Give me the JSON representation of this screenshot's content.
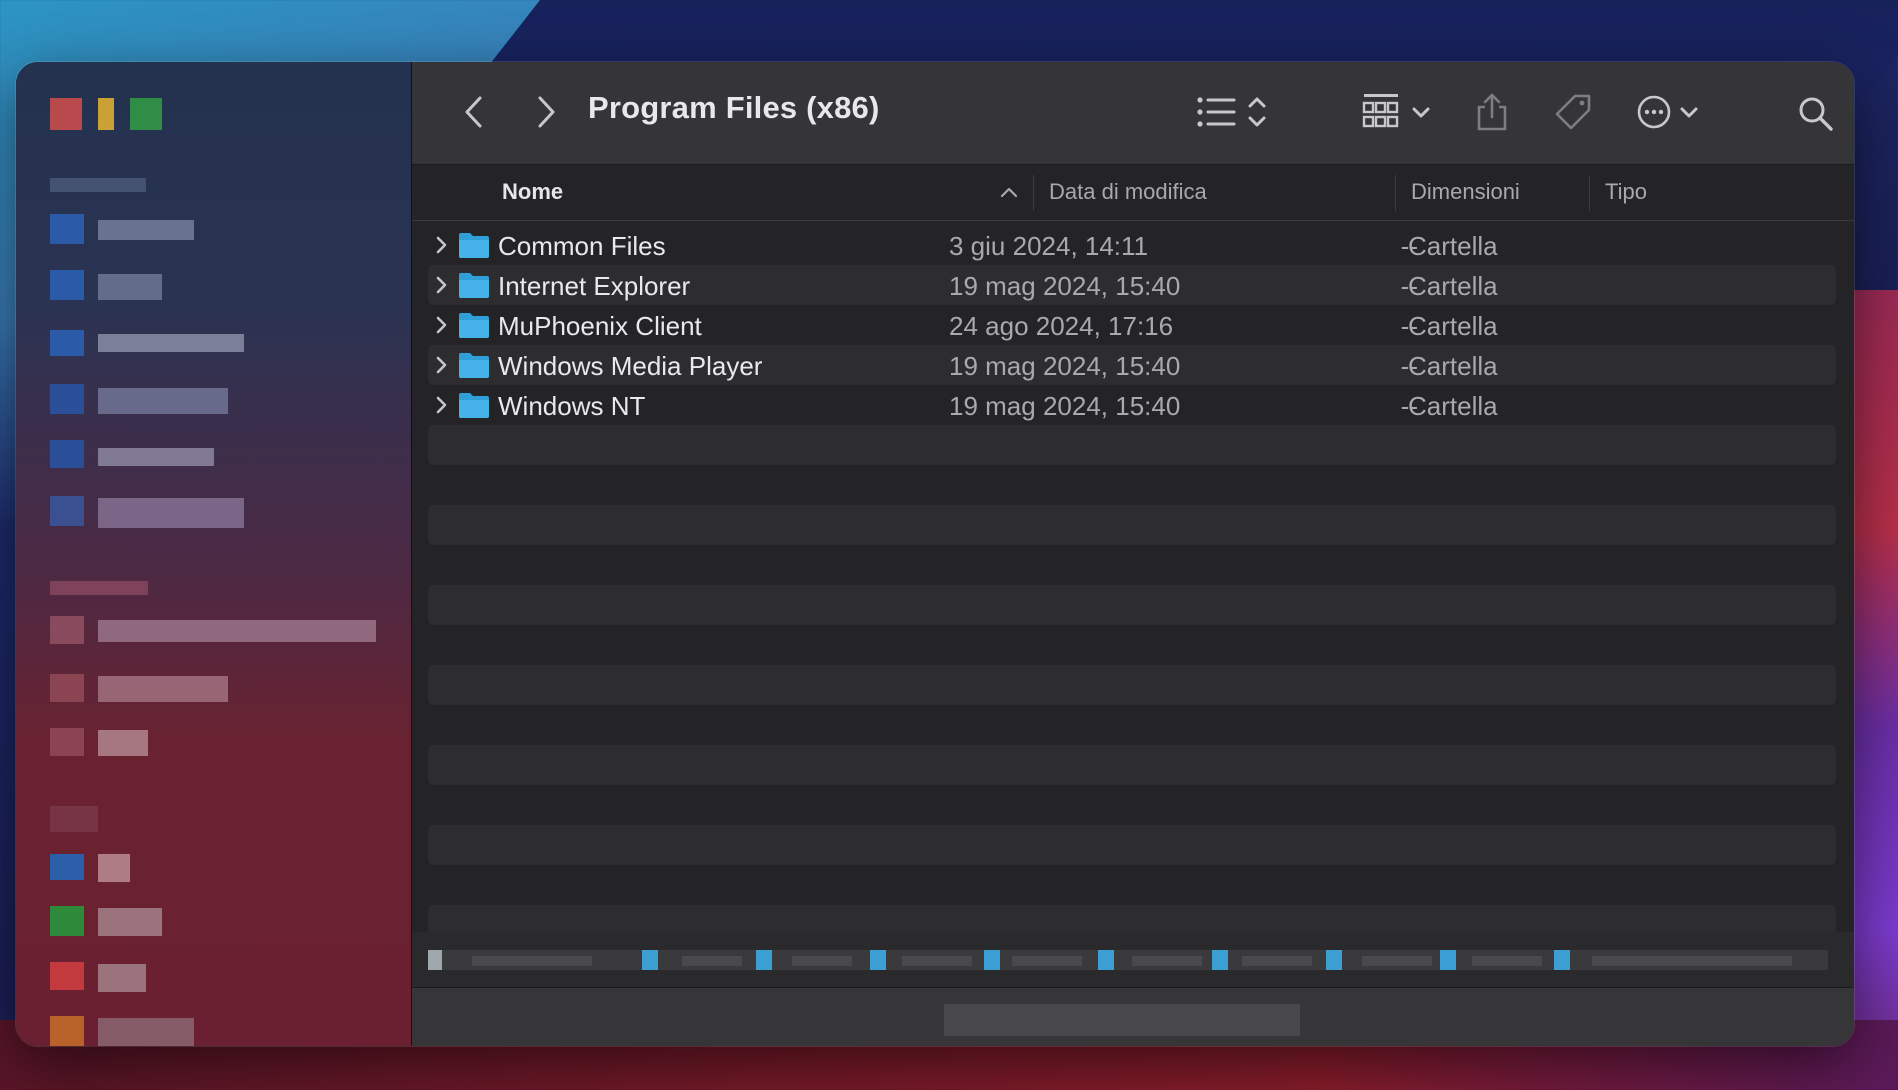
{
  "window": {
    "title": "Program Files (x86)"
  },
  "toolbar": {
    "back_icon": "chevron-left-icon",
    "forward_icon": "chevron-right-icon",
    "view_icon": "list-view-icon",
    "group_icon": "group-grid-icon",
    "share_icon": "share-icon",
    "tag_icon": "tag-icon",
    "more_icon": "ellipsis-circle-icon",
    "search_icon": "search-icon"
  },
  "columns": {
    "name": "Nome",
    "date": "Data di modifica",
    "size": "Dimensioni",
    "kind": "Tipo"
  },
  "files": [
    {
      "name": "Common Files",
      "date": "3 giu 2024, 14:11",
      "size": "--",
      "kind": "Cartella"
    },
    {
      "name": "Internet Explorer",
      "date": "19 mag 2024, 15:40",
      "size": "--",
      "kind": "Cartella"
    },
    {
      "name": "MuPhoenix Client",
      "date": "24 ago 2024, 17:16",
      "size": "--",
      "kind": "Cartella"
    },
    {
      "name": "Windows Media Player",
      "date": "19 mag 2024, 15:40",
      "size": "--",
      "kind": "Cartella"
    },
    {
      "name": "Windows NT",
      "date": "19 mag 2024, 15:40",
      "size": "--",
      "kind": "Cartella"
    }
  ],
  "colors": {
    "folder": "#45b3ea",
    "folder_tab": "#2f9fd9"
  }
}
